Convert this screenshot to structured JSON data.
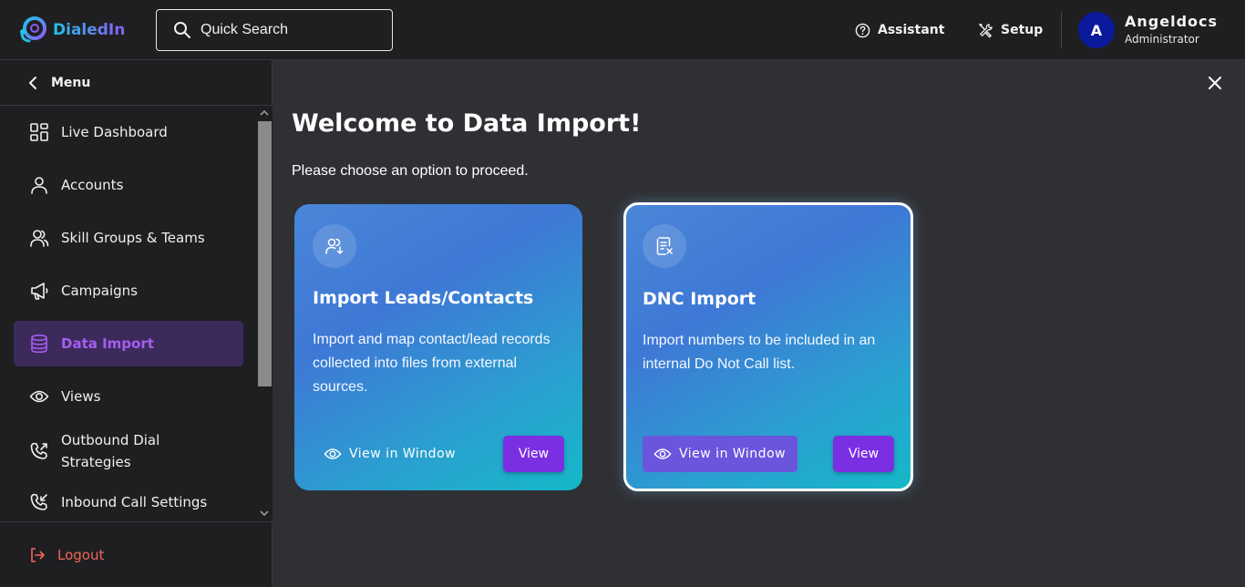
{
  "header": {
    "logo_text": "DialedIn",
    "search_label": "Quick Search",
    "assistant_label": "Assistant",
    "setup_label": "Setup",
    "avatar_initial": "A",
    "user_name": "Angeldocs",
    "user_role": "Administrator"
  },
  "sidebar": {
    "menu_label": "Menu",
    "items": [
      {
        "label": "Live Dashboard",
        "icon": "dashboard-icon"
      },
      {
        "label": "Accounts",
        "icon": "user-icon"
      },
      {
        "label": "Skill Groups & Teams",
        "icon": "users-icon"
      },
      {
        "label": "Campaigns",
        "icon": "megaphone-icon"
      },
      {
        "label": "Data Import",
        "icon": "database-icon",
        "active": true
      },
      {
        "label": "Views",
        "icon": "eye-icon"
      },
      {
        "label": "Outbound Dial",
        "label2": "Strategies",
        "icon": "phone-outgoing-icon"
      },
      {
        "label": "Inbound Call Settings",
        "icon": "phone-incoming-icon"
      }
    ],
    "logout_label": "Logout"
  },
  "main": {
    "title": "Welcome to Data Import!",
    "subtitle": "Please choose an option to proceed.",
    "cards": [
      {
        "icon": "user-import-icon",
        "title": "Import Leads/Contacts",
        "description": "Import and map contact/lead records collected into files from external sources.",
        "view_window_label": "View in Window",
        "view_label": "View"
      },
      {
        "icon": "document-x-icon",
        "title": "DNC Import",
        "description": "Import numbers to be included in an internal Do Not Call list.",
        "view_window_label": "View in Window",
        "view_label": "View"
      }
    ]
  },
  "colors": {
    "accent": "#7b2fe3",
    "active_nav_bg": "#3d2a5c",
    "active_nav_text": "#a65ef0",
    "logout": "#f0665a",
    "avatar_bg": "#0a1a9a"
  }
}
